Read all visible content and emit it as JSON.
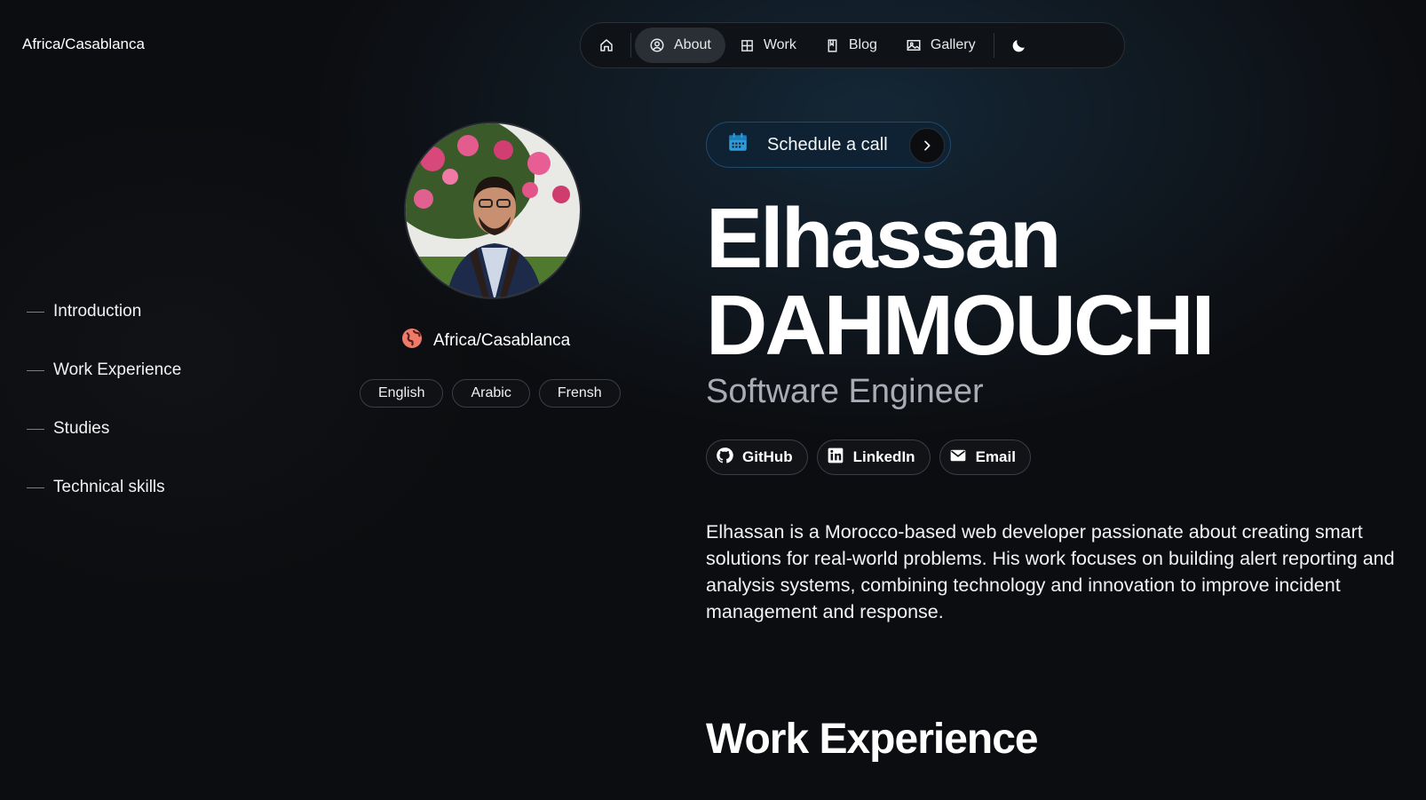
{
  "header": {
    "timezone": "Africa/Casablanca"
  },
  "nav": {
    "items": [
      {
        "label": "About",
        "icon": "user-circle-icon",
        "active": true
      },
      {
        "label": "Work",
        "icon": "grid-icon"
      },
      {
        "label": "Blog",
        "icon": "book-icon"
      },
      {
        "label": "Gallery",
        "icon": "image-icon"
      }
    ],
    "theme_icon": "moon-icon"
  },
  "toc": {
    "items": [
      "Introduction",
      "Work Experience",
      "Studies",
      "Technical skills"
    ]
  },
  "profile": {
    "location": "Africa/Casablanca",
    "languages": [
      "English",
      "Arabic",
      "Frensh"
    ]
  },
  "hero": {
    "schedule_label": "Schedule a call",
    "first_name": "Elhassan",
    "last_name": "DAHMOUCHI",
    "role": "Software Engineer",
    "socials": [
      {
        "label": "GitHub",
        "icon": "github-icon"
      },
      {
        "label": "LinkedIn",
        "icon": "linkedin-icon"
      },
      {
        "label": "Email",
        "icon": "mail-icon"
      }
    ],
    "bio": "Elhassan is a Morocco-based web developer passionate about creating smart solutions for real-world problems. His work focuses on building alert reporting and analysis systems, combining technology and innovation to improve incident management and response."
  },
  "sections": {
    "work_experience_title": "Work Experience"
  },
  "colors": {
    "accent": "#2d9cdb",
    "background": "#0c0d10",
    "schedule_bg": "#0e2233"
  }
}
